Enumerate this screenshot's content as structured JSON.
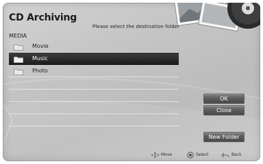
{
  "dialog": {
    "title": "CD Archiving",
    "instruction": "Please select the destination folder",
    "section_label": "MEDIA"
  },
  "folders": [
    {
      "label": "Movie",
      "icon": "folder-icon",
      "selected": false
    },
    {
      "label": "Music",
      "icon": "folder-icon",
      "selected": true
    },
    {
      "label": "Photo",
      "icon": "folder-icon",
      "selected": false
    }
  ],
  "buttons": {
    "ok": "OK",
    "close": "Close",
    "new_folder": "New Folder"
  },
  "hints": [
    {
      "icon": "dpad-move-icon",
      "label": "Move"
    },
    {
      "icon": "select-button-icon",
      "label": "Select"
    },
    {
      "icon": "back-arrow-icon",
      "label": "Back"
    }
  ],
  "colors": {
    "panel_background": "#c8c8c8",
    "selected_row": "#2a2a2a",
    "button": "#5a5a5a",
    "button_text": "#ffffff"
  }
}
